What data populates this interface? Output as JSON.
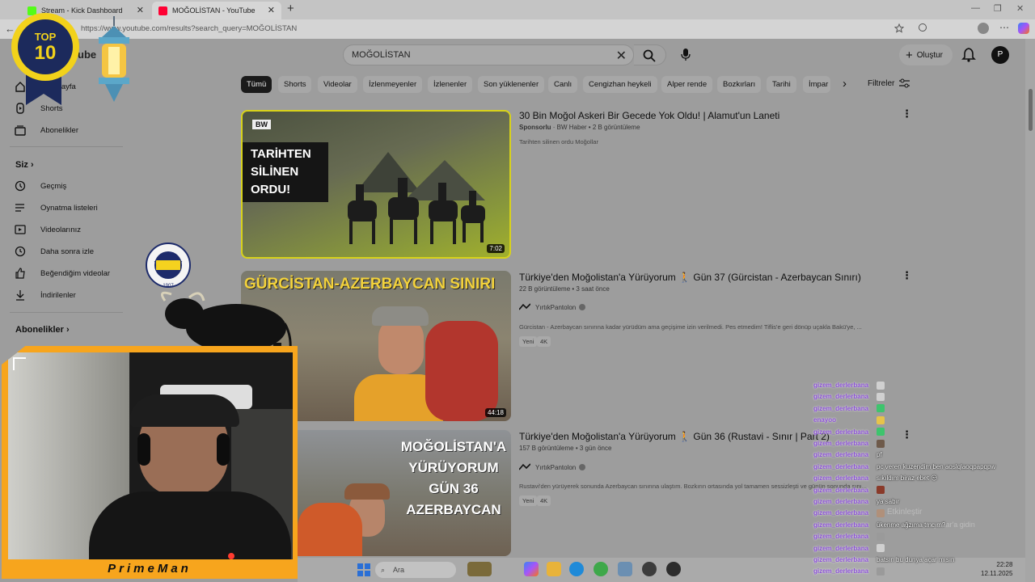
{
  "browser": {
    "tabs": [
      {
        "title": "Stream - Kick Dashboard",
        "active": false
      },
      {
        "title": "MOĞOLİSTAN - YouTube",
        "active": true
      }
    ],
    "new_tab": "+",
    "url": "https://www.youtube.com/results?search_query=MOĞOLİSTAN"
  },
  "youtube": {
    "logo_text": "ube",
    "search": {
      "query": "MOĞOLİSTAN"
    },
    "create_label": "Oluştur",
    "avatar_letter": "P",
    "sidebar": {
      "items_top": [
        {
          "label": "Ana Sayfa",
          "icon": "home-icon"
        },
        {
          "label": "Shorts",
          "icon": "shorts-icon"
        },
        {
          "label": "Abonelikler",
          "icon": "subscriptions-icon"
        }
      ],
      "you_heading": "Siz",
      "items_you": [
        {
          "label": "Geçmiş",
          "icon": "history-icon"
        },
        {
          "label": "Oynatma listeleri",
          "icon": "playlist-icon"
        },
        {
          "label": "Videolarınız",
          "icon": "your-videos-icon"
        },
        {
          "label": "Daha sonra izle",
          "icon": "watch-later-icon"
        },
        {
          "label": "Beğendiğim videolar",
          "icon": "like-icon"
        },
        {
          "label": "İndirilenler",
          "icon": "download-icon"
        }
      ],
      "subs_heading": "Abonelikler"
    },
    "chips": [
      "Tümü",
      "Shorts",
      "Videolar",
      "İzlenmeyenler",
      "İzlenenler",
      "Son yüklenenler",
      "Canlı",
      "Cengizhan heykeli",
      "Alper rende",
      "Bozkırları",
      "Tarihi",
      "İmpar"
    ],
    "filters_label": "Filtreler",
    "videos": [
      {
        "title": "30 Bin Moğol Askeri Bir Gecede Yok Oldu! | Alamut'un Laneti",
        "sponsored": "Sponsorlu",
        "channel": "BW Haber",
        "views": "2 B görüntüleme",
        "desc": "Tarihten silinen ordu Moğollar",
        "duration": "7:02",
        "thumb_text": "TARİHTEN SİLİNEN ORDU!",
        "thumb_logo": "BW"
      },
      {
        "title": "Türkiye'den Moğolistan'a Yürüyorum 🚶 Gün 37 (Gürcistan - Azerbaycan Sınırı)",
        "meta": "22 B görüntüleme • 3 saat önce",
        "channel": "YırtıkPantolon",
        "desc": "Gürcistan - Azerbaycan sınırına kadar yürüdüm ama geçişime izin verilmedi. Pes etmedim! Tiflis'e geri dönüp uçakla Bakü'ye, ...",
        "badges": [
          "Yeni",
          "4K"
        ],
        "duration": "44:18",
        "thumb_text": "GÜRCİSTAN-AZERBAYCAN SINIRI"
      },
      {
        "title": "Türkiye'den Moğolistan'a Yürüyorum 🚶 Gün 36 (Rustavi - Sınır | Part 2)",
        "meta": "157 B görüntüleme • 3 gün önce",
        "channel": "YırtıkPantolon",
        "desc": "Rustavi'den yürüyerek sonunda Azerbaycan sınırına ulaştım. Bozkırın ortasında yol tamamen sessizleşti ve günün sonunda sını...",
        "badges": [
          "Yeni",
          "4K"
        ],
        "thumb_text": "MOĞOLİSTAN'A YÜRÜYORUM GÜN 36 AZERBAYCAN"
      }
    ]
  },
  "overlay": {
    "top10_label": "TOP",
    "top10_number": "10",
    "club_badge_year": "1907",
    "club_badge_text": "FENERBAHÇE SPOR KULÜBÜ",
    "streamer_name": "PrimeMan",
    "chat": [
      {
        "user": "gizem_derlerbana",
        "msg": ""
      },
      {
        "user": "gizem_derlerbana",
        "msg": ""
      },
      {
        "user": "gizem_derlerbana",
        "msg": ""
      },
      {
        "user": "enayoo",
        "msg": ""
      },
      {
        "user": "gizem_derlerbana",
        "msg": ""
      },
      {
        "user": "gizem_derlerbana",
        "msg": ""
      },
      {
        "user": "gizem_derlerbana",
        "msg": "pf"
      },
      {
        "user": "gizem_derlerbana",
        "msg": "pc veren kuzendim ben aoslqlaoqpapqpw"
      },
      {
        "user": "gizem_derlerbana",
        "msg": "sıkıldım biraz ebet 😒"
      },
      {
        "user": "gizem_derlerbana",
        "msg": ""
      },
      {
        "user": "gizem_derlerbana",
        "msg": "ya sabır"
      },
      {
        "user": "gizem_derlerbana",
        "msg": ""
      },
      {
        "user": "gizem_derlerbana",
        "msg": "ükenme ağzıma tmcım?"
      },
      {
        "user": "gizem_derlerbana",
        "msg": ""
      },
      {
        "user": "gizem_derlerbana",
        "msg": ""
      },
      {
        "user": "gizem_derlerbana",
        "msg": "batsın bu dunya açar mısın"
      },
      {
        "user": "gizem_derlerbana",
        "msg": ""
      }
    ],
    "ghost_text": [
      "Etkinleştir",
      "ayarlar'a gidin"
    ]
  },
  "taskbar": {
    "search_placeholder": "Ara",
    "time": "22:28",
    "date": "12.11.2025"
  },
  "colors": {
    "accent": "#f7a51d",
    "chat_user": "#8a4fd6",
    "youtube_red": "#ff0033"
  }
}
